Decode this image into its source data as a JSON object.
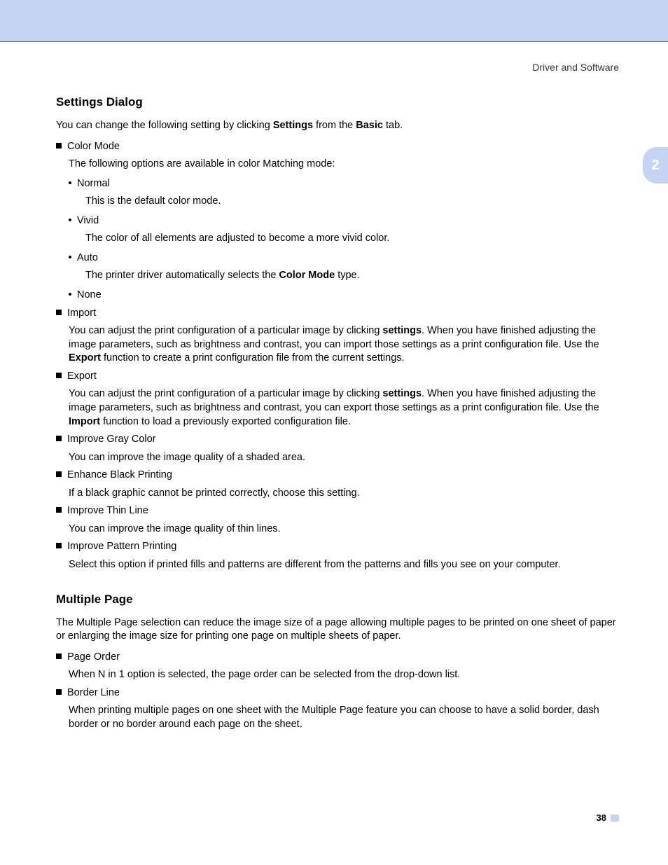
{
  "header": {
    "section": "Driver and Software"
  },
  "sideTab": {
    "label": "2"
  },
  "settingsDialog": {
    "title": "Settings Dialog",
    "intro": {
      "pre": "You can change the following setting by clicking ",
      "b1": "Settings",
      "mid": " from the ",
      "b2": "Basic",
      "post": " tab."
    },
    "colorMode": {
      "label": "Color Mode",
      "desc": "The following options are available in color Matching mode:",
      "normal": {
        "label": "Normal",
        "body": "This is the default color mode."
      },
      "vivid": {
        "label": "Vivid",
        "body": "The color of all elements are adjusted to become a more vivid color."
      },
      "auto": {
        "label": "Auto",
        "body_pre": "The printer driver automatically selects the ",
        "body_b": "Color Mode",
        "body_post": " type."
      },
      "none": {
        "label": "None"
      }
    },
    "import": {
      "label": "Import",
      "body_pre": "You can adjust the print configuration of a particular image by clicking ",
      "body_b1": "settings",
      "body_mid": ". When you have finished adjusting the image parameters, such as brightness and contrast, you can import those settings as a print configuration file. Use the ",
      "body_b2": "Export",
      "body_post": " function to create a print configuration file from the current settings."
    },
    "export": {
      "label": "Export",
      "body_pre": "You can adjust the print configuration of a particular image by clicking ",
      "body_b1": "settings",
      "body_mid": ". When you have finished adjusting the image parameters, such as brightness and contrast, you can export those settings as a print configuration file. Use the ",
      "body_b2": "Import",
      "body_post": " function to load a previously exported configuration file."
    },
    "improveGray": {
      "label": "Improve Gray Color",
      "body": "You can improve the image quality of a shaded area."
    },
    "enhanceBlack": {
      "label": "Enhance Black Printing",
      "body": "If a black graphic cannot be printed correctly, choose this setting."
    },
    "improveThin": {
      "label": "Improve Thin Line",
      "body": "You can improve the image quality of thin lines."
    },
    "improvePattern": {
      "label": "Improve Pattern Printing",
      "body": "Select this option if printed fills and patterns are different from the patterns and fills you see on your computer."
    }
  },
  "multiplePage": {
    "title": "Multiple Page",
    "intro": "The Multiple Page selection can reduce the image size of a page allowing multiple pages to be printed on one sheet of paper or enlarging the image size for printing one page on multiple sheets of paper.",
    "pageOrder": {
      "label": "Page Order",
      "body": "When N in 1 option is selected, the page order can be selected from the drop-down list."
    },
    "borderLine": {
      "label": "Border Line",
      "body": "When printing multiple pages on one sheet with the Multiple Page feature you can choose to have a solid border, dash border or no border around each page on the sheet."
    }
  },
  "pageNumber": "38"
}
